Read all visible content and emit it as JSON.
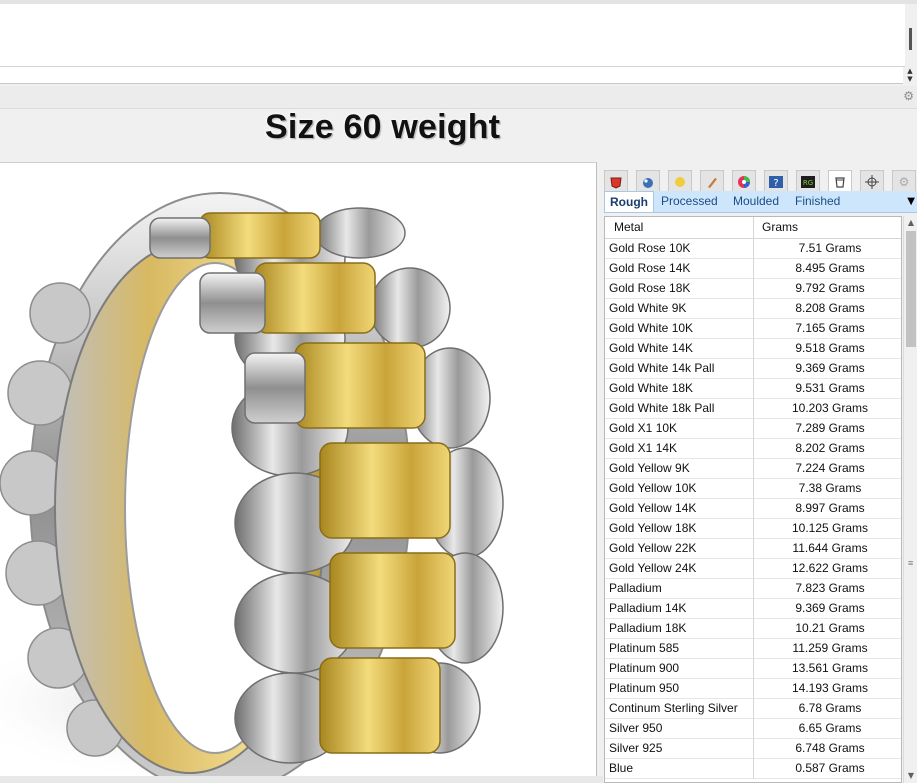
{
  "window": {
    "view_title": "Size 60 weight"
  },
  "panel": {
    "tabs": [
      {
        "label": "Rough",
        "active": true
      },
      {
        "label": "Processed",
        "active": false
      },
      {
        "label": "Moulded",
        "active": false
      },
      {
        "label": "Finished",
        "active": false
      }
    ],
    "icons": [
      "properties-icon",
      "material-sphere-icon",
      "light-icon",
      "brush-icon",
      "color-wheel-icon",
      "help-icon",
      "rg-icon",
      "jewelry-weight-icon",
      "target-icon",
      "gear-icon"
    ],
    "rg_icon_text": "RG",
    "help_icon_text": "?",
    "table": {
      "columns": [
        "Metal",
        "Grams"
      ],
      "rows": [
        {
          "metal": "Gold Rose 10K",
          "grams": "7.51 Grams"
        },
        {
          "metal": "Gold Rose 14K",
          "grams": "8.495 Grams"
        },
        {
          "metal": "Gold Rose 18K",
          "grams": "9.792 Grams"
        },
        {
          "metal": "Gold White 9K",
          "grams": "8.208 Grams"
        },
        {
          "metal": "Gold White 10K",
          "grams": "7.165 Grams"
        },
        {
          "metal": "Gold White 14K",
          "grams": "9.518 Grams"
        },
        {
          "metal": "Gold White 14k Pall",
          "grams": "9.369 Grams"
        },
        {
          "metal": "Gold White 18K",
          "grams": "9.531 Grams"
        },
        {
          "metal": "Gold White 18k Pall",
          "grams": "10.203 Grams"
        },
        {
          "metal": "Gold X1 10K",
          "grams": "7.289 Grams"
        },
        {
          "metal": "Gold X1 14K",
          "grams": "8.202 Grams"
        },
        {
          "metal": "Gold Yellow 9K",
          "grams": "7.224 Grams"
        },
        {
          "metal": "Gold Yellow 10K",
          "grams": "7.38 Grams"
        },
        {
          "metal": "Gold Yellow 14K",
          "grams": "8.997 Grams"
        },
        {
          "metal": "Gold Yellow 18K",
          "grams": "10.125 Grams"
        },
        {
          "metal": "Gold Yellow 22K",
          "grams": "11.644 Grams"
        },
        {
          "metal": "Gold Yellow 24K",
          "grams": "12.622 Grams"
        },
        {
          "metal": "Palladium",
          "grams": "7.823 Grams"
        },
        {
          "metal": "Palladium 14K",
          "grams": "9.369 Grams"
        },
        {
          "metal": "Palladium 18K",
          "grams": "10.21 Grams"
        },
        {
          "metal": "Platinum 585",
          "grams": "11.259 Grams"
        },
        {
          "metal": "Platinum 900",
          "grams": "13.561 Grams"
        },
        {
          "metal": "Platinum 950",
          "grams": "14.193 Grams"
        },
        {
          "metal": "Continum Sterling Silver",
          "grams": "6.78 Grams"
        },
        {
          "metal": "Silver 950",
          "grams": "6.65 Grams"
        },
        {
          "metal": "Silver 925",
          "grams": "6.748 Grams"
        },
        {
          "metal": "Blue",
          "grams": "0.587 Grams"
        }
      ]
    }
  },
  "colors": {
    "tab_bar": "#cde6fb",
    "gold": "#d9b544",
    "silver": "#a9a9a9"
  }
}
